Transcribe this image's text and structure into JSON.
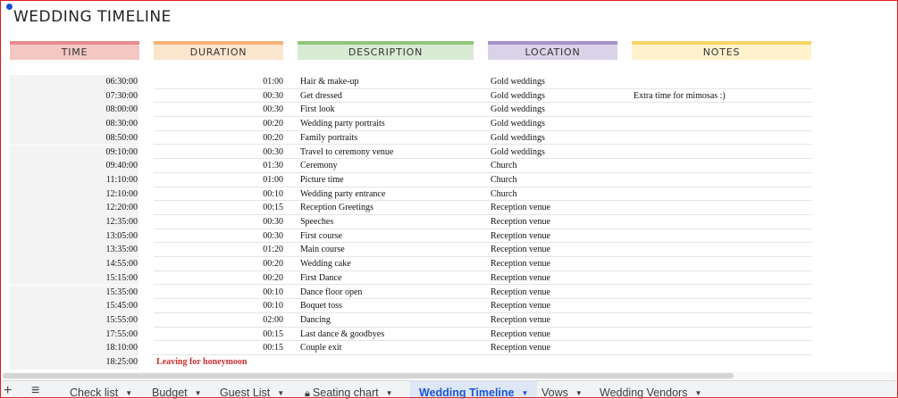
{
  "title": "WEDDING TIMELINE",
  "headers": [
    {
      "key": "time",
      "label": "TIME",
      "color": "#e78b8e",
      "bg": "#f4c7c3"
    },
    {
      "key": "duration",
      "label": "DURATION",
      "color": "#f4b17a",
      "bg": "#fce5cd"
    },
    {
      "key": "description",
      "label": "DESCRIPTION",
      "color": "#93c47d",
      "bg": "#d9ead3"
    },
    {
      "key": "location",
      "label": "LOCATION",
      "color": "#a593c9",
      "bg": "#d9d2e9"
    },
    {
      "key": "notes",
      "label": "NOTES",
      "color": "#f6d467",
      "bg": "#fff2cc"
    }
  ],
  "rows": [
    {
      "time": "06:30:00",
      "duration": "01:00",
      "description": "Hair & make-up",
      "location": "Gold weddings",
      "notes": ""
    },
    {
      "time": "07:30:00",
      "duration": "00:30",
      "description": "Get dressed",
      "location": "Gold weddings",
      "notes": "Extra time for mimosas :)"
    },
    {
      "time": "08:00:00",
      "duration": "00:30",
      "description": "First look",
      "location": "Gold weddings",
      "notes": ""
    },
    {
      "time": "08:30:00",
      "duration": "00:20",
      "description": "Wedding party portraits",
      "location": "Gold weddings",
      "notes": ""
    },
    {
      "time": "08:50:00",
      "duration": "00:20",
      "description": "Family portraits",
      "location": "Gold weddings",
      "notes": ""
    },
    {
      "time": "09:10:00",
      "duration": "00:30",
      "description": "Travel to ceremony venue",
      "location": "Gold weddings",
      "notes": ""
    },
    {
      "time": "09:40:00",
      "duration": "01:30",
      "description": "Ceremony",
      "location": "Church",
      "notes": ""
    },
    {
      "time": "11:10:00",
      "duration": "01:00",
      "description": "Picture time",
      "location": "Church",
      "notes": ""
    },
    {
      "time": "12:10:00",
      "duration": "00:10",
      "description": "Wedding party entrance",
      "location": "Church",
      "notes": ""
    },
    {
      "time": "12:20:00",
      "duration": "00:15",
      "description": "Reception Greetings",
      "location": "Reception venue",
      "notes": ""
    },
    {
      "time": "12:35:00",
      "duration": "00:30",
      "description": "Speeches",
      "location": "Reception venue",
      "notes": ""
    },
    {
      "time": "13:05:00",
      "duration": "00:30",
      "description": "First course",
      "location": "Reception venue",
      "notes": ""
    },
    {
      "time": "13:35:00",
      "duration": "01:20",
      "description": "Main course",
      "location": "Reception venue",
      "notes": ""
    },
    {
      "time": "14:55:00",
      "duration": "00:20",
      "description": "Wedding cake",
      "location": "Reception venue",
      "notes": ""
    },
    {
      "time": "15:15:00",
      "duration": "00:20",
      "description": "First Dance",
      "location": "Reception venue",
      "notes": ""
    },
    {
      "time": "15:35:00",
      "duration": "00:10",
      "description": "Dance floor open",
      "location": "Reception venue",
      "notes": ""
    },
    {
      "time": "15:45:00",
      "duration": "00:10",
      "description": "Boquet toss",
      "location": "Reception venue",
      "notes": ""
    },
    {
      "time": "15:55:00",
      "duration": "02:00",
      "description": "Dancing",
      "location": "Reception venue",
      "notes": ""
    },
    {
      "time": "17:55:00",
      "duration": "00:15",
      "description": "Last dance & goodbyes",
      "location": "Reception venue",
      "notes": ""
    },
    {
      "time": "18:10:00",
      "duration": "00:15",
      "description": "Couple exit",
      "location": "Reception venue",
      "notes": ""
    }
  ],
  "final_row": {
    "time": "18:25:00",
    "label": "Leaving for honeymoon"
  },
  "toolbar": {
    "add_icon": "plus-icon",
    "menu_icon": "hamburger-menu-icon",
    "add_glyph": "+",
    "menu_glyph": "≡"
  },
  "tabs": [
    {
      "label": "Check list",
      "active": false,
      "locked": false
    },
    {
      "label": "Budget",
      "active": false,
      "locked": false
    },
    {
      "label": "Guest List",
      "active": false,
      "locked": false
    },
    {
      "label": "Seating chart",
      "active": false,
      "locked": true
    },
    {
      "label": "Wedding Timeline",
      "active": true,
      "locked": false
    },
    {
      "label": "Vows",
      "active": false,
      "locked": false
    },
    {
      "label": "Wedding Vendors",
      "active": false,
      "locked": false
    }
  ]
}
